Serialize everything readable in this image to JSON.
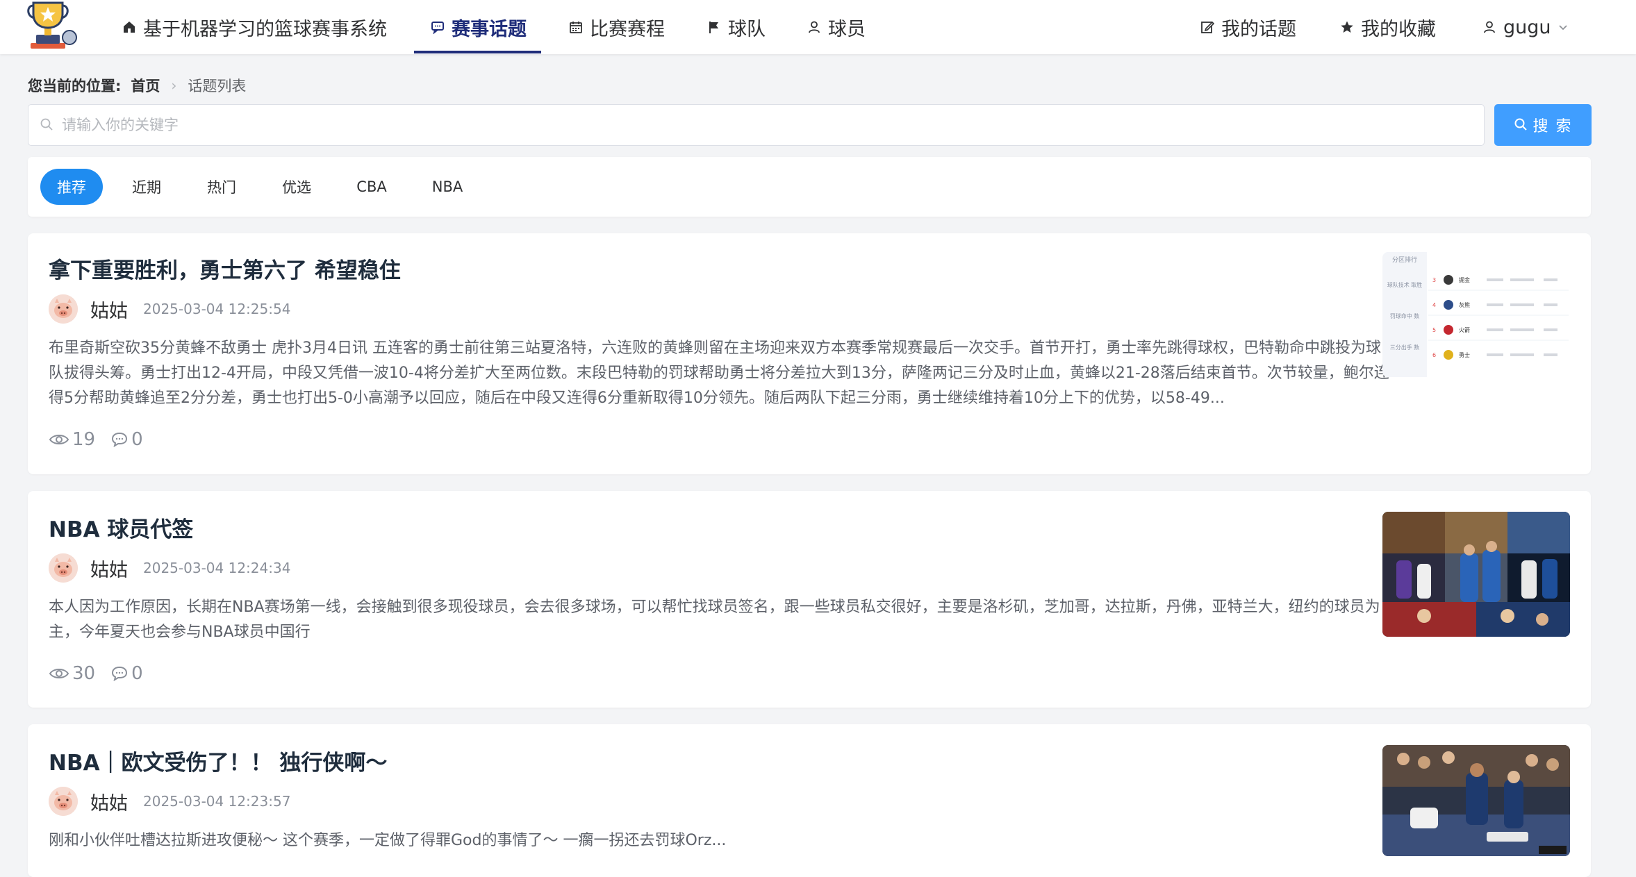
{
  "header": {
    "nav": [
      {
        "label": "基于机器学习的篮球赛事系统",
        "icon": "home-icon"
      },
      {
        "label": "赛事话题",
        "icon": "chat-icon"
      },
      {
        "label": "比赛赛程",
        "icon": "calendar-icon"
      },
      {
        "label": "球队",
        "icon": "flag-icon"
      },
      {
        "label": "球员",
        "icon": "user-icon"
      }
    ],
    "right": [
      {
        "label": "我的话题",
        "icon": "edit-icon"
      },
      {
        "label": "我的收藏",
        "icon": "star-icon"
      },
      {
        "label": "gugu",
        "icon": "user-icon"
      }
    ]
  },
  "breadcrumb": {
    "prefix": "您当前的位置:",
    "home": "首页",
    "current": "话题列表"
  },
  "search": {
    "placeholder": "请输入你的关键字",
    "button": "搜 索"
  },
  "tabs": [
    "推荐",
    "近期",
    "热门",
    "优选",
    "CBA",
    "NBA"
  ],
  "posts": [
    {
      "title": "拿下重要胜利，勇士第六了 希望稳住",
      "author": "姑姑",
      "time": "2025-03-04 12:25:54",
      "excerpt": "布里奇斯空砍35分黄蜂不敌勇士 虎扑3月4日讯 五连客的勇士前往第三站夏洛特，六连败的黄蜂则留在主场迎来双方本赛季常规赛最后一次交手。首节开打，勇士率先跳得球权，巴特勒命中跳投为球队拔得头筹。勇士打出12-4开局，中段又凭借一波10-4将分差扩大至两位数。末段巴特勒的罚球帮助勇士将分差拉大到13分，萨隆两记三分及时止血，黄蜂以21-28落后结束首节。次节较量，鲍尔连得5分帮助黄蜂追至2分分差，勇士也打出5-0小高潮予以回应，随后在中段又连得6分重新取得10分领先。随后两队下起三分雨，勇士继续维持着10分上下的优势，以58-49...",
      "views": "19",
      "comments": "0"
    },
    {
      "title": "NBA 球员代签",
      "author": "姑姑",
      "time": "2025-03-04 12:24:34",
      "excerpt": "本人因为工作原因，长期在NBA赛场第一线，会接触到很多现役球员，会去很多球场，可以帮忙找球员签名，跟一些球员私交很好，主要是洛杉矶，芝加哥，达拉斯，丹佛，亚特兰大，纽约的球员为主，今年夏天也会参与NBA球员中国行",
      "views": "30",
      "comments": "0"
    },
    {
      "title": "NBA｜欧文受伤了！！ 独行侠啊～",
      "author": "姑姑",
      "time": "2025-03-04 12:23:57",
      "excerpt": "刚和小伙伴吐槽达拉斯进攻便秘～ 这个赛季，一定做了得罪God的事情了～ 一瘸一拐还去罚球Orz...",
      "views": "",
      "comments": ""
    }
  ],
  "thumb1": {
    "side_labels": [
      "分区排行",
      "球队技术 取胜",
      "罚球命中 数",
      "三分出手 数"
    ],
    "ranks": [
      "3",
      "4",
      "5",
      "6"
    ],
    "teams": [
      "掘金",
      "灰熊",
      "火箭",
      "勇士"
    ]
  }
}
